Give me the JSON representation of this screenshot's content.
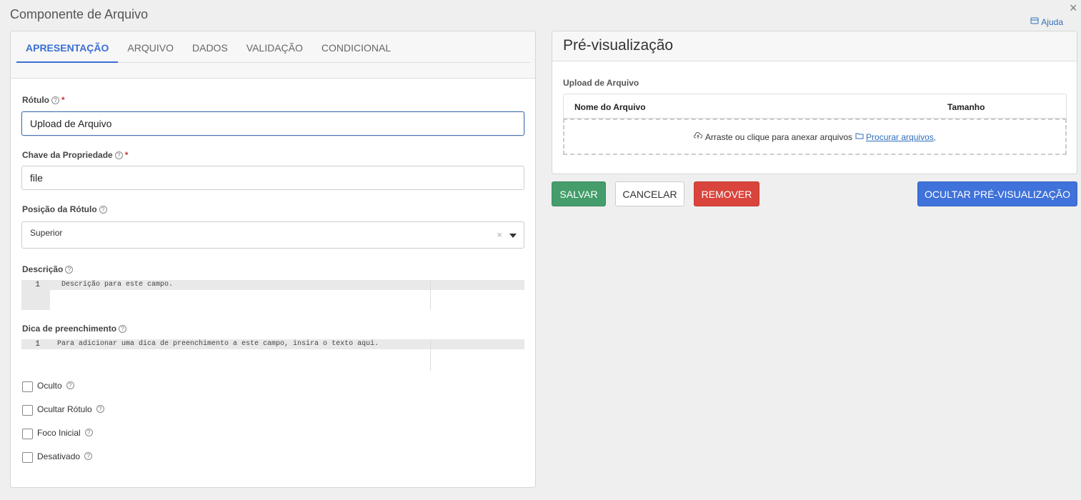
{
  "dialog": {
    "title": "Componente de Arquivo",
    "help_label": "Ajuda",
    "close_glyph": "×"
  },
  "tabs": [
    {
      "label": "APRESENTAÇÃO",
      "active": true
    },
    {
      "label": "ARQUIVO",
      "active": false
    },
    {
      "label": "DADOS",
      "active": false
    },
    {
      "label": "VALIDAÇÃO",
      "active": false
    },
    {
      "label": "CONDICIONAL",
      "active": false
    }
  ],
  "form": {
    "label_field": {
      "label": "Rótulo",
      "required_mark": "*",
      "value": "Upload de Arquivo"
    },
    "key_field": {
      "label": "Chave da Propriedade",
      "required_mark": "*",
      "value": "file"
    },
    "label_position": {
      "label": "Posição da Rótulo",
      "value": "Superior",
      "clear_glyph": "×"
    },
    "description": {
      "label": "Descrição",
      "line_number": "1",
      "text": "Descrição para este campo."
    },
    "tooltip": {
      "label": "Dica de preenchimento",
      "line_number": "1",
      "text": "Para adicionar uma dica de preenchimento a este campo, insira o texto aqui."
    },
    "checkboxes": [
      {
        "label": "Oculto",
        "checked": false
      },
      {
        "label": "Ocultar Rótulo",
        "checked": false
      },
      {
        "label": "Foco Inicial",
        "checked": false
      },
      {
        "label": "Desativado",
        "checked": false
      }
    ],
    "help_glyph": "?"
  },
  "preview": {
    "title": "Pré-visualização",
    "component_label": "Upload de Arquivo",
    "columns": [
      "Nome do Arquivo",
      "Tamanho"
    ],
    "dropzone_text": "Arraste ou clique para anexar arquivos",
    "browse_link": "Procurar arquivos,"
  },
  "actions": {
    "save": "SALVAR",
    "cancel": "CANCELAR",
    "remove": "REMOVER",
    "hide_preview": "OCULTAR PRÉ-VISUALIZAÇÃO"
  },
  "colors": {
    "accent": "#3b6fd4",
    "save": "#449d6b",
    "remove": "#d9443c",
    "hide_preview": "#3f72da"
  },
  "icons": [
    "close-icon",
    "help-book-icon",
    "question-icon",
    "caret-down-icon",
    "clear-icon",
    "cloud-upload-icon",
    "folder-icon"
  ]
}
